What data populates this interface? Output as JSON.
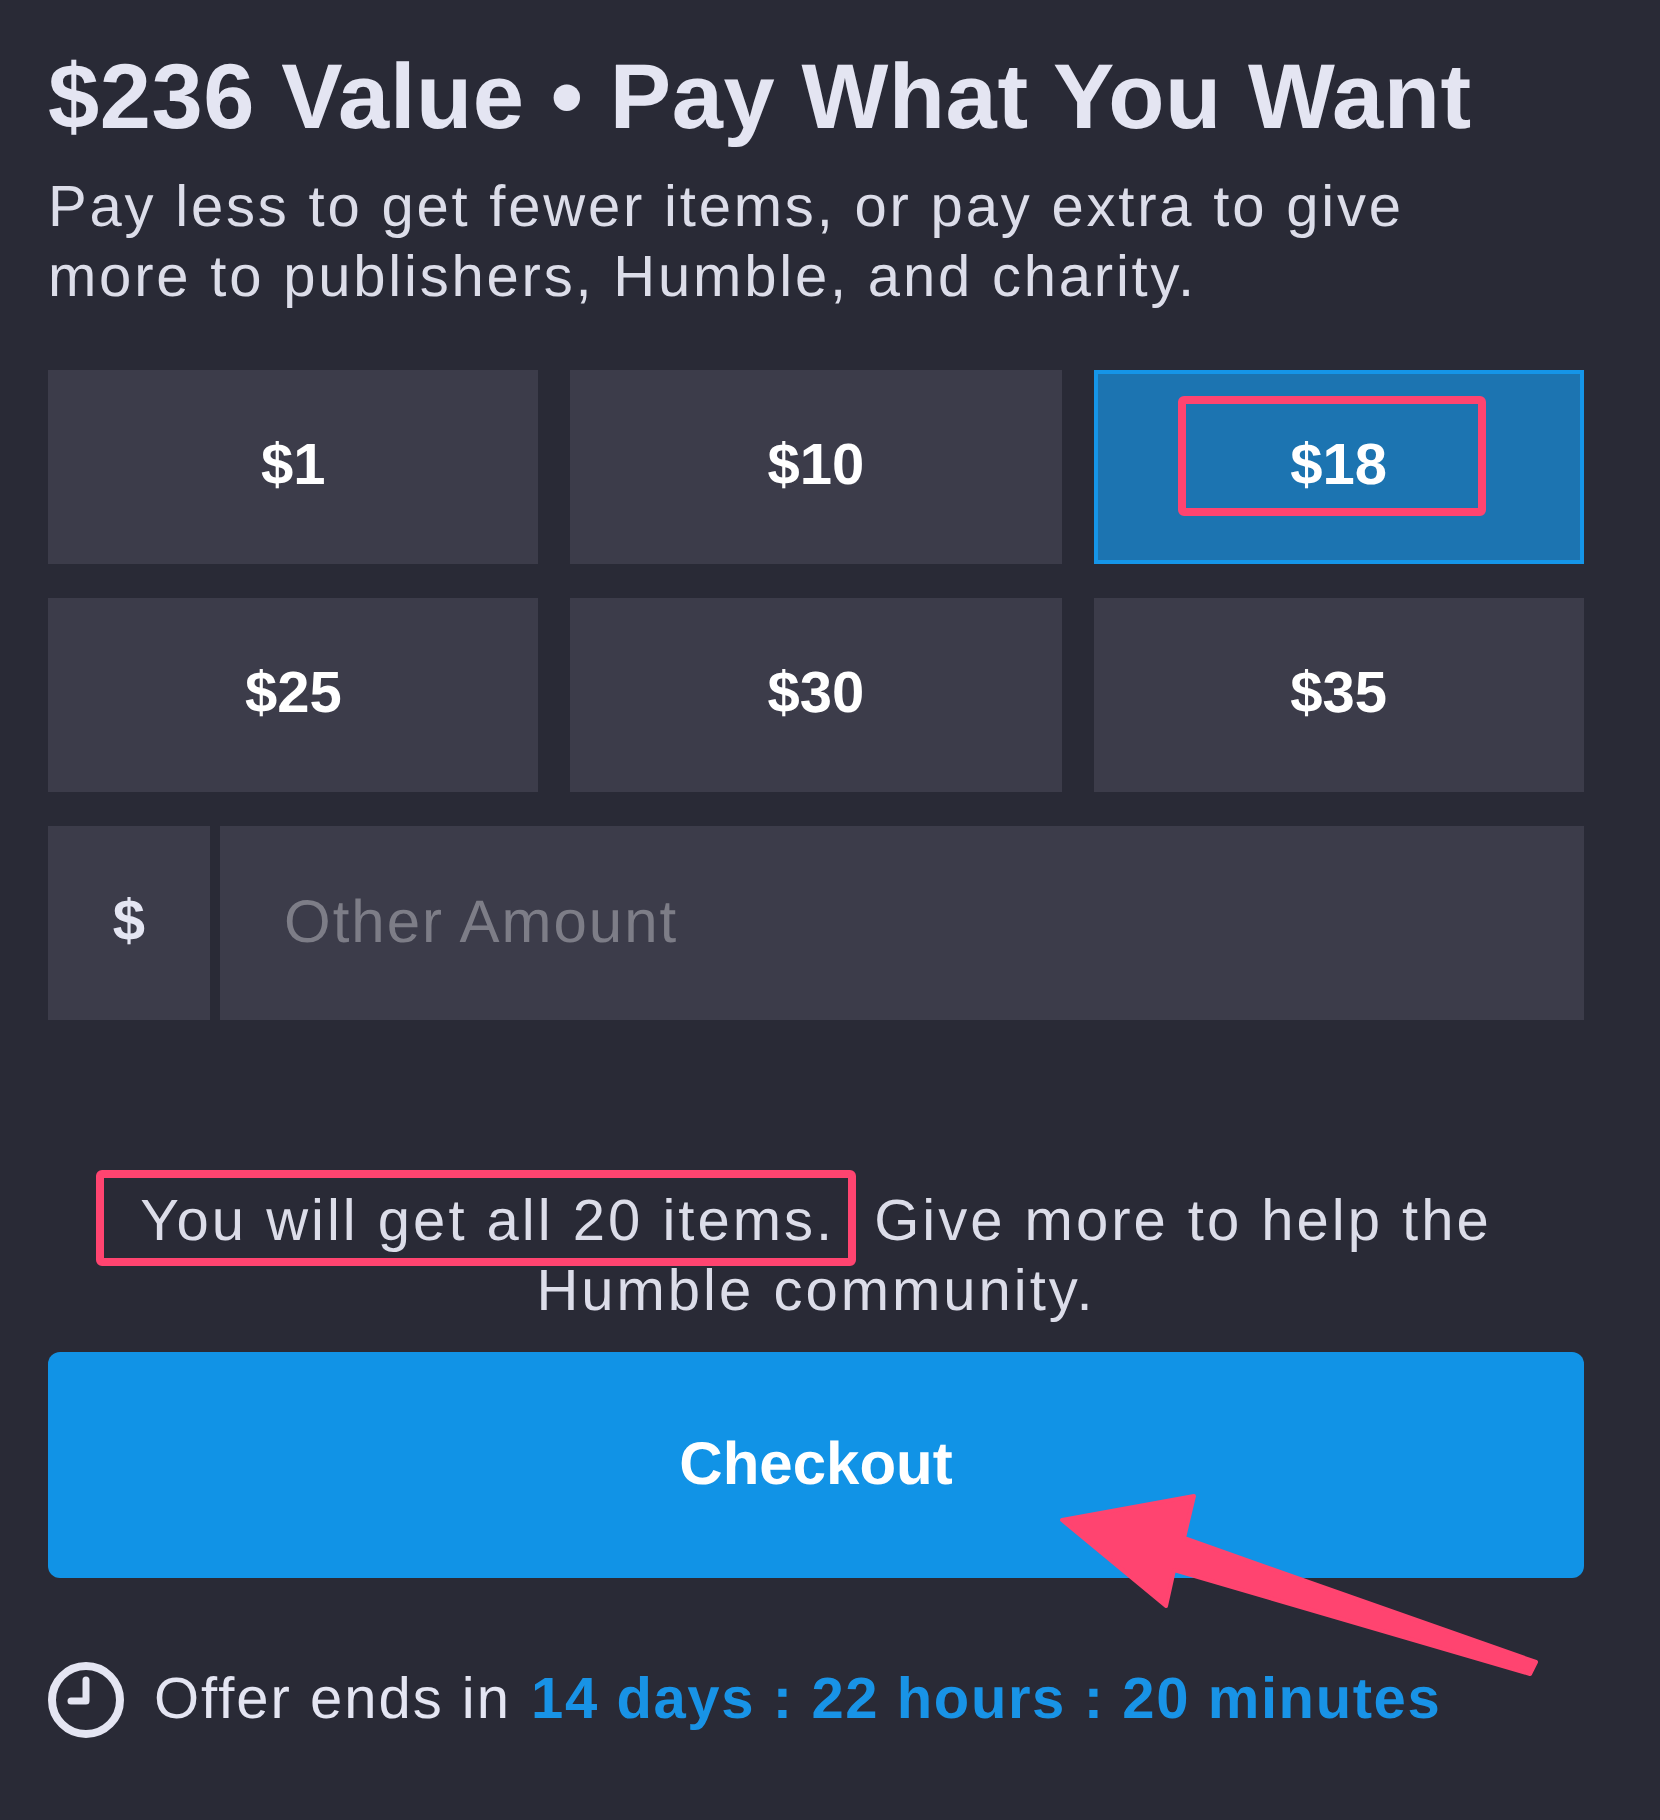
{
  "header": {
    "title": "$236 Value • Pay What You Want",
    "description": "Pay less to get fewer items, or pay extra to give more to publishers, Humble, and charity."
  },
  "price_options": [
    {
      "label": "$1",
      "selected": false,
      "highlighted": false
    },
    {
      "label": "$10",
      "selected": false,
      "highlighted": false
    },
    {
      "label": "$18",
      "selected": true,
      "highlighted": true
    },
    {
      "label": "$25",
      "selected": false,
      "highlighted": false
    },
    {
      "label": "$30",
      "selected": false,
      "highlighted": false
    },
    {
      "label": "$35",
      "selected": false,
      "highlighted": false
    }
  ],
  "custom_amount": {
    "prefix": "$",
    "placeholder": "Other Amount"
  },
  "notice": {
    "framed_text": "You will get all 20 items.",
    "text": "Give more to help the Humble community."
  },
  "checkout": {
    "label": "Checkout",
    "pointed_at": true
  },
  "offer": {
    "label": "Offer ends in",
    "countdown": "14 days : 22 hours : 20 minutes"
  }
}
